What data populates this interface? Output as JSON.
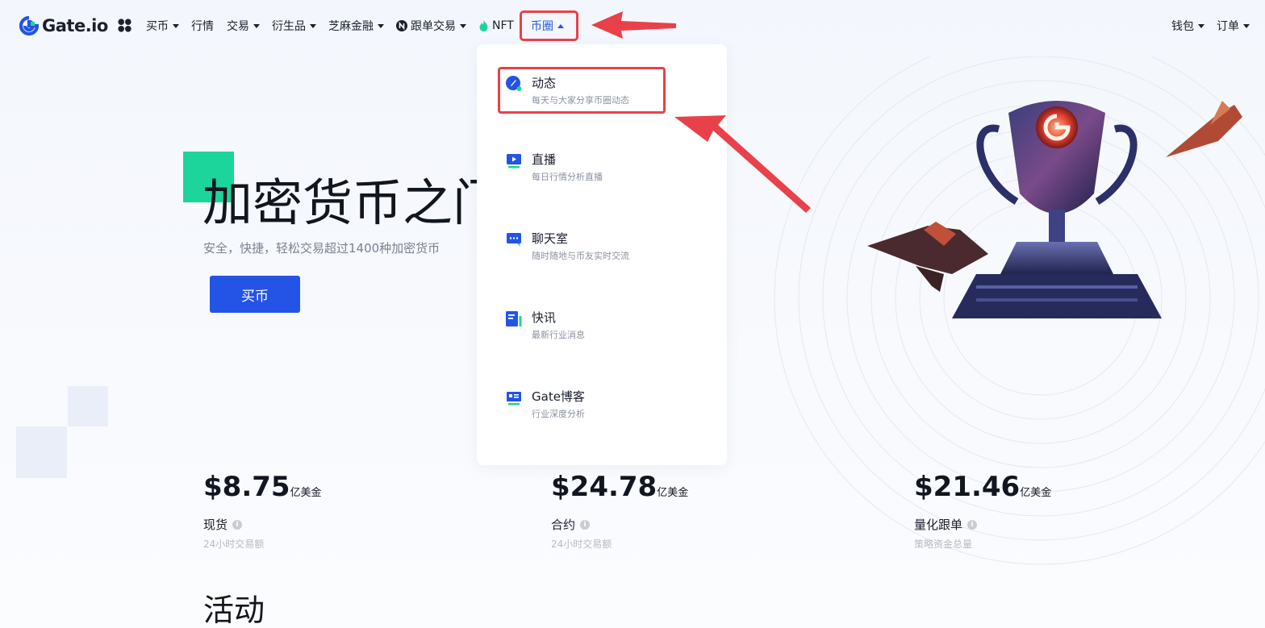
{
  "brand": {
    "name": "Gate.io",
    "accent": "#2354e6",
    "logo_green": "#1bd59b"
  },
  "nav": {
    "left": [
      {
        "id": "buy",
        "label": "买币",
        "has_caret": true
      },
      {
        "id": "market",
        "label": "行情",
        "has_caret": false
      },
      {
        "id": "trade",
        "label": "交易",
        "has_caret": true
      },
      {
        "id": "derivatives",
        "label": "衍生品",
        "has_caret": true
      },
      {
        "id": "finance",
        "label": "芝麻金融",
        "has_caret": true
      },
      {
        "id": "copy",
        "label": "跟单交易",
        "has_caret": true
      },
      {
        "id": "nft",
        "label": "NFT",
        "has_caret": false
      },
      {
        "id": "circle",
        "label": "币圈",
        "has_caret": true,
        "active": true
      }
    ],
    "right": [
      {
        "id": "wallet",
        "label": "钱包"
      },
      {
        "id": "orders",
        "label": "订单"
      }
    ]
  },
  "dropdown": {
    "items": [
      {
        "icon": "dynamics-icon",
        "title": "动态",
        "subtitle": "每天与大家分享币圈动态",
        "highlighted": true
      },
      {
        "icon": "live-icon",
        "title": "直播",
        "subtitle": "每日行情分析直播"
      },
      {
        "icon": "chat-icon",
        "title": "聊天室",
        "subtitle": "随时随地与币友实时交流"
      },
      {
        "icon": "news-icon",
        "title": "快讯",
        "subtitle": "最新行业消息"
      },
      {
        "icon": "blog-icon",
        "title": "Gate博客",
        "subtitle": "行业深度分析"
      }
    ]
  },
  "hero": {
    "title": "加密货币之门",
    "subtitle": "安全，快捷，轻松交易超过1400种加密货币",
    "cta": "买币"
  },
  "stats": [
    {
      "value": "$8.75",
      "unit": "亿美金",
      "label": "现货",
      "sub": "24小时交易额"
    },
    {
      "value": "$24.78",
      "unit": "亿美金",
      "label": "合约",
      "sub": "24小时交易额"
    },
    {
      "value": "$21.46",
      "unit": "亿美金",
      "label": "量化跟单",
      "sub": "策略资金总量"
    }
  ],
  "section": {
    "title": "活动"
  },
  "annotation_color": "#e8414a"
}
